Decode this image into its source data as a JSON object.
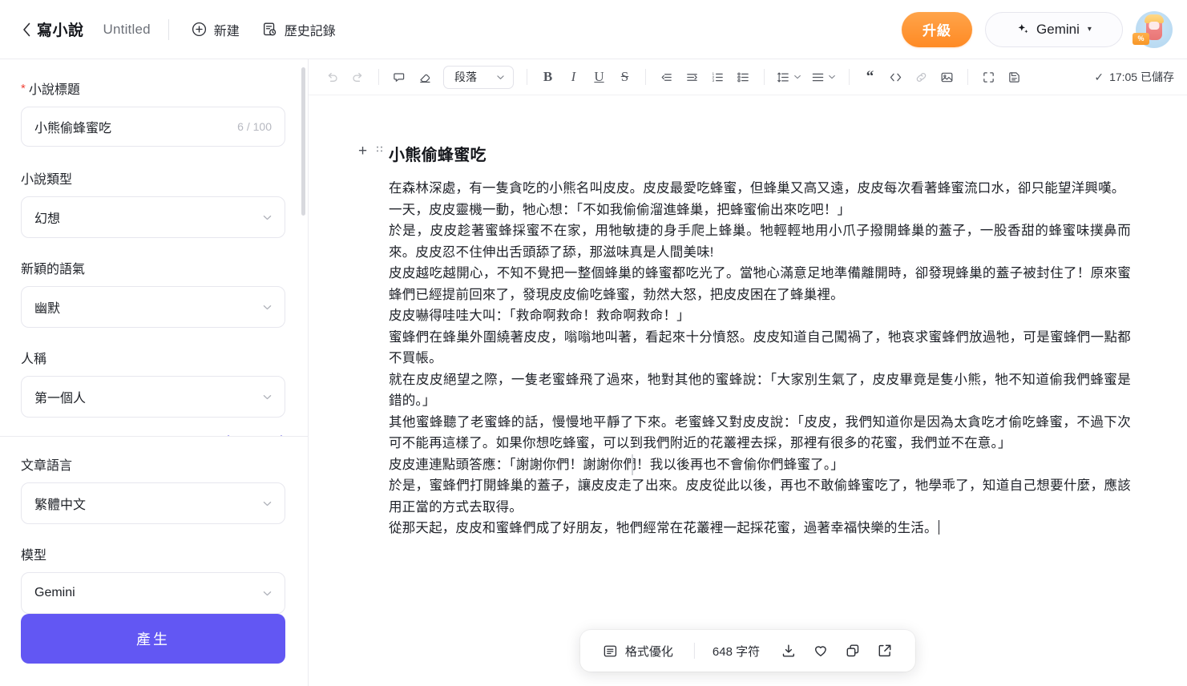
{
  "topbar": {
    "back_icon": "chevron-left-icon",
    "app_title": "寫小說",
    "doc_title": "Untitled",
    "new_label": "新建",
    "new_icon": "plus-circle-icon",
    "history_label": "歷史記錄",
    "history_icon": "history-document-icon",
    "upgrade_label": "升級",
    "model_label": "Gemini",
    "model_icon": "sparkle-icon",
    "model_caret": "▾",
    "avatar_badge": "%",
    "colors": {
      "upgrade_bg": "#ff8a24",
      "generate_bg": "#6257f3",
      "required_star": "#f04438"
    }
  },
  "sidebar": {
    "title_field": {
      "label": "小說標題",
      "required": true,
      "value": "小熊偷蜂蜜吃",
      "counter": "6 / 100"
    },
    "fields": [
      {
        "label": "小說類型",
        "value": "幻想"
      },
      {
        "label": "新穎的語氣",
        "value": "幽默"
      },
      {
        "label": "人稱",
        "value": "第一個人"
      }
    ],
    "clipped_row_label": "· · · · ·",
    "language_field": {
      "label": "文章語言",
      "value": "繁體中文"
    },
    "model_field": {
      "label": "模型",
      "value": "Gemini"
    },
    "generate_label": "產生"
  },
  "editor": {
    "toolbar": {
      "undo": "undo-icon",
      "redo": "redo-icon",
      "comment": "comment-icon",
      "clear_format": "eraser-icon",
      "paragraph_label": "段落",
      "bold": "B",
      "italic": "I",
      "underline": "U",
      "strikethrough": "S",
      "outdent": "outdent-icon",
      "indent": "indent-icon",
      "ordered_list": "ordered-list-icon",
      "bullet_list": "bullet-list-icon",
      "line_height": "line-height-icon",
      "align": "align-icon",
      "quote": "quote-icon",
      "code": "code-icon",
      "link": "link-icon",
      "image": "image-icon",
      "fullscreen": "fullscreen-icon",
      "save": "save-icon",
      "save_status": "17:05 已儲存",
      "save_check": "✓"
    },
    "document": {
      "heading": "小熊偷蜂蜜吃",
      "paragraphs": [
        "在森林深處，有一隻貪吃的小熊名叫皮皮。皮皮最愛吃蜂蜜，但蜂巢又高又遠，皮皮每次看著蜂蜜流口水，卻只能望洋興嘆。",
        "一天，皮皮靈機一動，牠心想：「不如我偷偷溜進蜂巢，把蜂蜜偷出來吃吧！」",
        "於是，皮皮趁著蜜蜂採蜜不在家，用牠敏捷的身手爬上蜂巢。牠輕輕地用小爪子撥開蜂巢的蓋子，一股香甜的蜂蜜味撲鼻而來。皮皮忍不住伸出舌頭舔了舔，那滋味真是人間美味!",
        "皮皮越吃越開心，不知不覺把一整個蜂巢的蜂蜜都吃光了。當牠心滿意足地準備離開時，卻發現蜂巢的蓋子被封住了！原來蜜蜂們已經提前回來了，發現皮皮偷吃蜂蜜，勃然大怒，把皮皮困在了蜂巢裡。",
        "皮皮嚇得哇哇大叫：「救命啊救命！救命啊救命！」",
        "蜜蜂們在蜂巢外圍繞著皮皮，嗡嗡地叫著，看起來十分憤怒。皮皮知道自己闖禍了，牠哀求蜜蜂們放過牠，可是蜜蜂們一點都不買帳。",
        "就在皮皮絕望之際，一隻老蜜蜂飛了過來，牠對其他的蜜蜂說：「大家別生氣了，皮皮畢竟是隻小熊，牠不知道偷我們蜂蜜是錯的。」",
        "其他蜜蜂聽了老蜜蜂的話，慢慢地平靜了下來。老蜜蜂又對皮皮說：「皮皮，我們知道你是因為太貪吃才偷吃蜂蜜，不過下次可不能再這樣了。如果你想吃蜂蜜，可以到我們附近的花叢裡去採，那裡有很多的花蜜，我們並不在意。」",
        "皮皮連連點頭答應：「謝謝你們！謝謝你們！我以後再也不會偷你們蜂蜜了。」",
        "於是，蜜蜂們打開蜂巢的蓋子，讓皮皮走了出來。皮皮從此以後，再也不敢偷蜂蜜吃了，牠學乖了，知道自己想要什麼，應該用正當的方式去取得。",
        "從那天起，皮皮和蜜蜂們成了好朋友，牠們經常在花叢裡一起採花蜜，過著幸福快樂的生活。"
      ]
    },
    "floatbar": {
      "format_label": "格式優化",
      "format_icon": "list-format-icon",
      "char_count": "648 字符",
      "download_icon": "download-icon",
      "favorite_icon": "heart-icon",
      "copy_icon": "copy-icon",
      "share_icon": "external-link-icon"
    }
  }
}
